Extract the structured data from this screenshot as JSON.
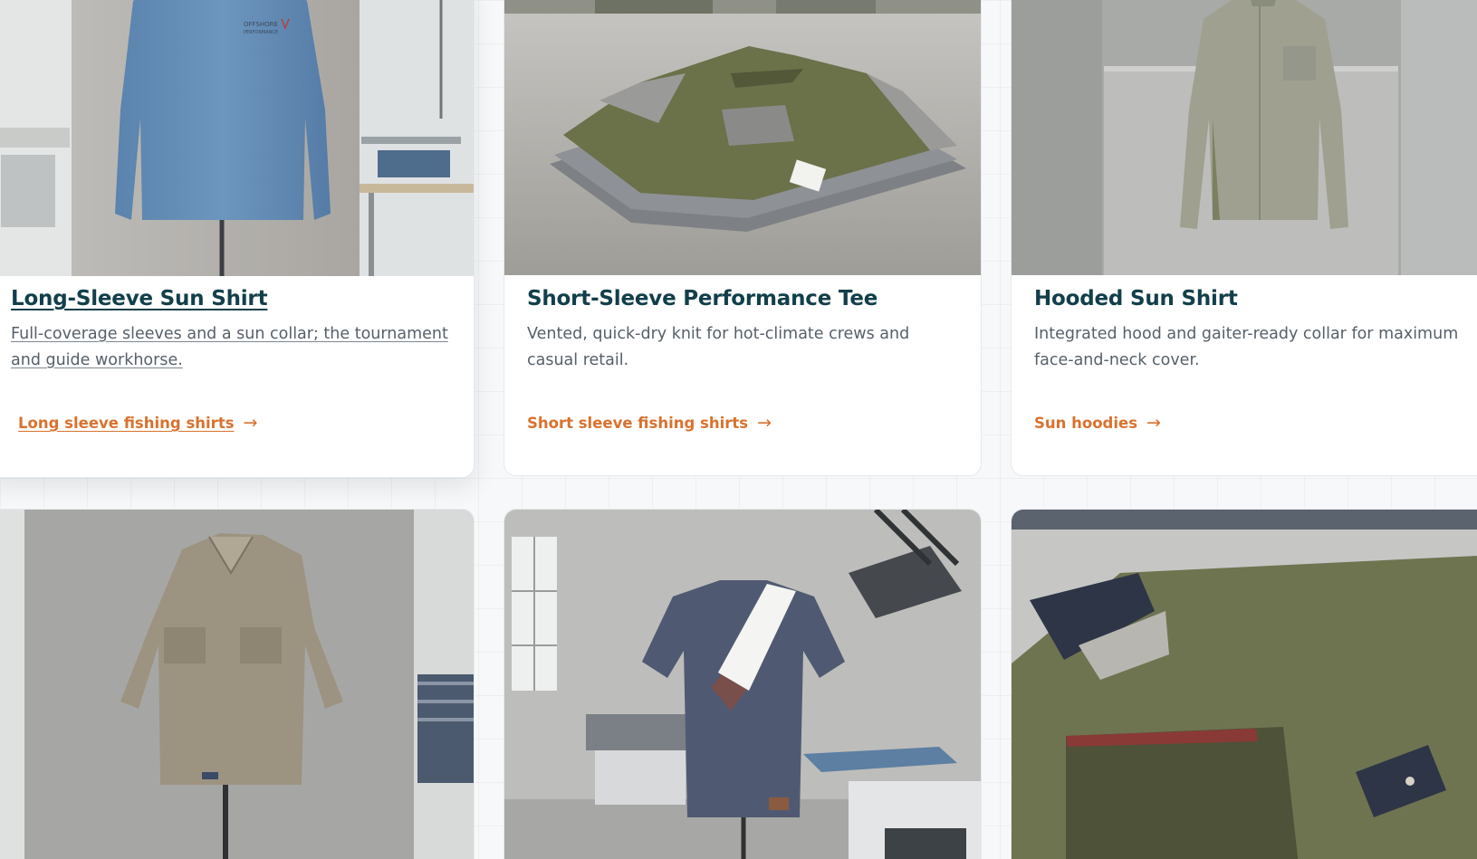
{
  "cards": [
    {
      "title": "Long-Sleeve Sun Shirt",
      "description": "Full-coverage sleeves and a sun collar; the tournament and guide workhorse.",
      "link": "Long sleeve fishing shirts",
      "arrow": "→",
      "print_brand": "OFFSHORE",
      "print_sub": "PERFORMANCE"
    },
    {
      "title": "Short-Sleeve Performance Tee",
      "description": "Vented, quick-dry knit for hot-climate crews and casual retail.",
      "link": "Short sleeve fishing shirts",
      "arrow": "→"
    },
    {
      "title": "Hooded Sun Shirt",
      "description": "Integrated hood and gaiter-ready collar for maximum face-and-neck cover.",
      "link": "Sun hoodies",
      "arrow": "→"
    }
  ],
  "colors": {
    "title": "#123f4a",
    "body_text": "#56606a",
    "link_accent": "#d9722f",
    "card_bg": "#ffffff",
    "page_bg": "#f7f8f9"
  }
}
